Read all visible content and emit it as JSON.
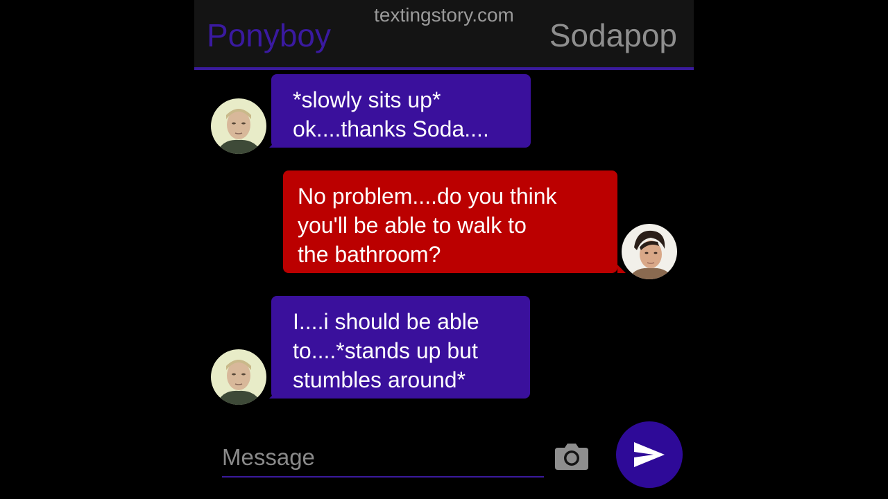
{
  "header": {
    "watermark": "textingstory.com",
    "left_contact": "Ponyboy",
    "right_contact": "Sodapop"
  },
  "messages": [
    {
      "sender": "Ponyboy",
      "side": "left",
      "text": "*slowly sits up*\nok....thanks Soda...."
    },
    {
      "sender": "Sodapop",
      "side": "right",
      "text": "No problem....do you think\nyou'll be able to walk to\nthe bathroom?"
    },
    {
      "sender": "Ponyboy",
      "side": "left",
      "text": "I....i should be able\nto....*stands up but\nstumbles around*"
    }
  ],
  "composer": {
    "placeholder": "Message",
    "camera_icon": "camera-icon",
    "send_icon": "send-icon"
  },
  "colors": {
    "left_bubble": "#3a109c",
    "right_bubble": "#bb0000",
    "accent": "#3a1a9c",
    "send_button": "#2e0a98"
  }
}
